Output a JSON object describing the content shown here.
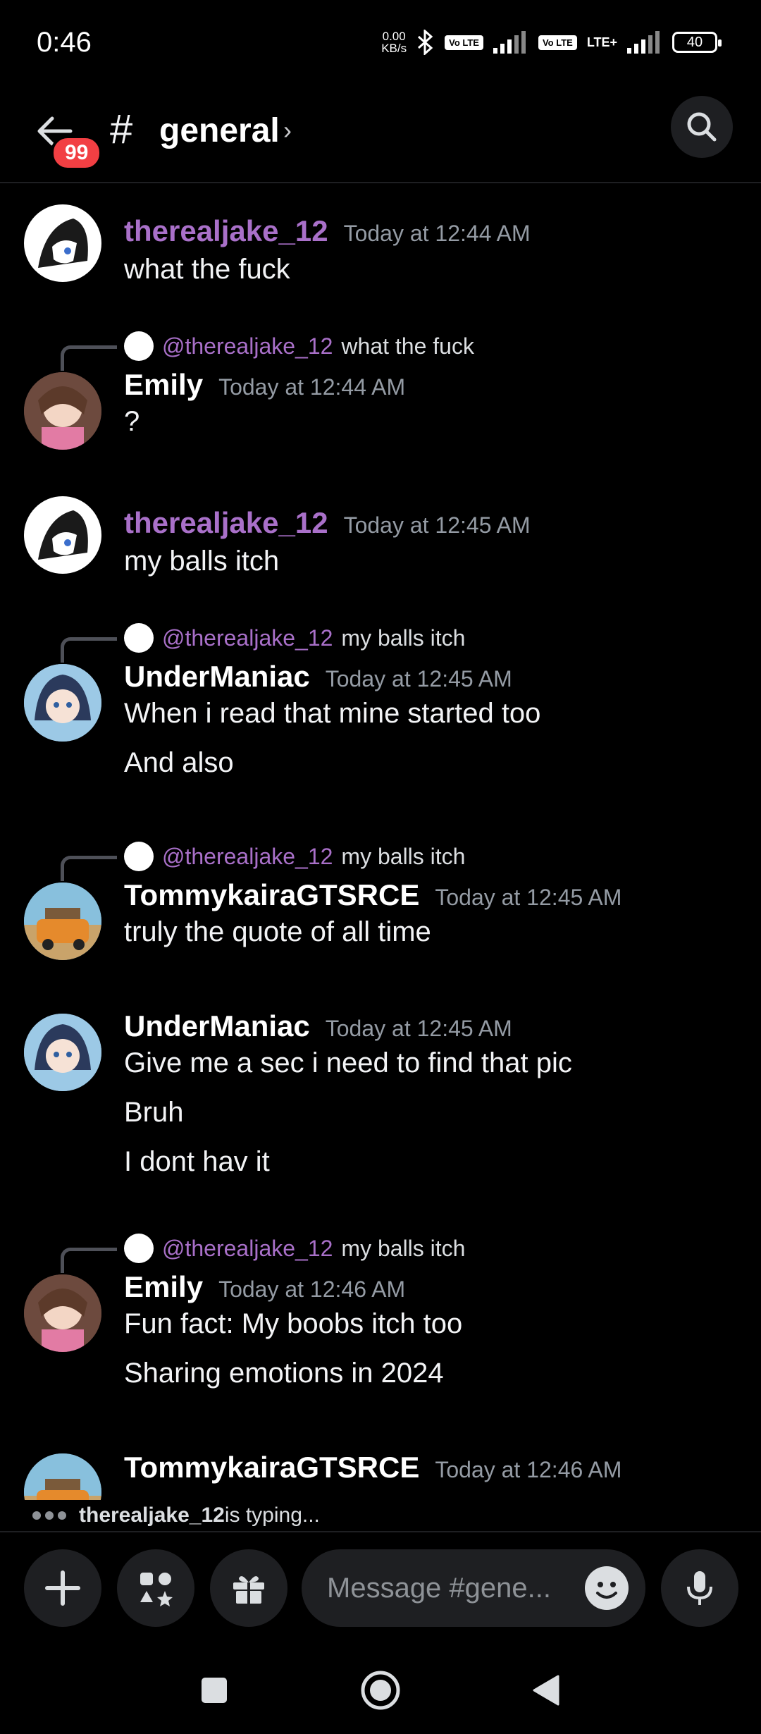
{
  "status_bar": {
    "time": "0:46",
    "net_speed_top": "0.00",
    "net_speed_bottom": "KB/s",
    "volte1": "Vo LTE",
    "volte2": "Vo LTE",
    "lte": "LTE+",
    "battery": "40"
  },
  "header": {
    "unread_badge": "99",
    "hash": "#",
    "channel_name": "general",
    "chevron": "›"
  },
  "messages": [
    {
      "username": "therealjake_12",
      "timestamp": "Today at 12:44 AM",
      "lines": [
        "what the fuck"
      ]
    },
    {
      "reply_mention": "@therealjake_12",
      "reply_text": "what the fuck",
      "username": "Emily",
      "timestamp": "Today at 12:44 AM",
      "lines": [
        "?"
      ]
    },
    {
      "username": "therealjake_12",
      "timestamp": "Today at 12:45 AM",
      "lines": [
        "my balls itch"
      ]
    },
    {
      "reply_mention": "@therealjake_12",
      "reply_text": "my balls itch",
      "username": "UnderManiac",
      "timestamp": "Today at 12:45 AM",
      "lines": [
        "When i read that mine started too",
        "And also"
      ]
    },
    {
      "reply_mention": "@therealjake_12",
      "reply_text": "my balls itch",
      "username": "TommykairaGTSRCE",
      "timestamp": "Today at 12:45 AM",
      "lines": [
        "truly the quote of all time"
      ]
    },
    {
      "username": "UnderManiac",
      "timestamp": "Today at 12:45 AM",
      "lines": [
        "Give me a sec i need to find that pic",
        "Bruh",
        "I dont hav it"
      ]
    },
    {
      "reply_mention": "@therealjake_12",
      "reply_text": "my balls itch",
      "username": "Emily",
      "timestamp": "Today at 12:46 AM",
      "lines": [
        "Fun fact: My boobs itch too",
        "Sharing emotions in 2024"
      ]
    },
    {
      "username": "TommykairaGTSRCE",
      "timestamp": "Today at 12:46 AM",
      "lines": []
    }
  ],
  "typing": {
    "user": "therealjake_12",
    "suffix": " is typing..."
  },
  "composer": {
    "placeholder": "Message #gene..."
  },
  "colors": {
    "mention_purple": "#a970c9",
    "badge_red": "#f23f43",
    "surface": "#1e1f22"
  },
  "icons": [
    "back-arrow-icon",
    "search-icon",
    "plus-icon",
    "apps-icon",
    "gift-icon",
    "emoji-icon",
    "microphone-icon",
    "nav-square-icon",
    "nav-home-icon",
    "nav-back-icon"
  ]
}
